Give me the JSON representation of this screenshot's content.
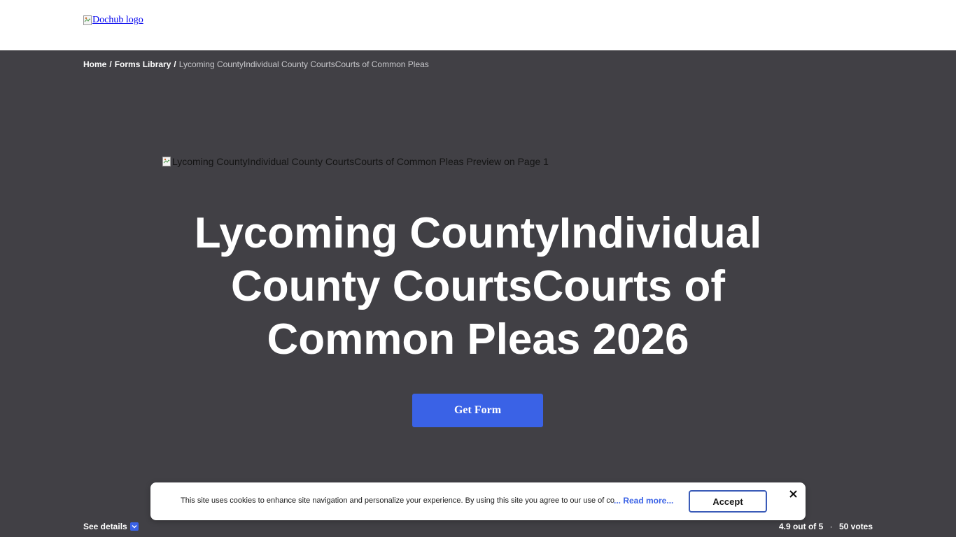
{
  "header": {
    "logo_alt": "Dochub logo"
  },
  "breadcrumb": {
    "home": "Home",
    "separator": "/",
    "forms_library": "Forms Library",
    "current": "Lycoming CountyIndividual County CourtsCourts of Common Pleas"
  },
  "preview": {
    "alt": "Lycoming CountyIndividual County CourtsCourts of Common Pleas Preview on Page 1"
  },
  "main": {
    "title": "Lycoming CountyIndividual County CourtsCourts of Common Pleas 2026",
    "get_form_label": "Get Form"
  },
  "footer": {
    "see_details_label": "See details",
    "rating_text": "4.9 out of 5",
    "rating_dot": "·",
    "votes_text": "50 votes"
  },
  "cookie": {
    "text": "This site uses cookies to enhance site navigation and personalize your experience. By using this site you agree to our use of cookies as described in our",
    "read_more": "... Read more...",
    "accept_label": "Accept"
  },
  "colors": {
    "background": "#414045",
    "accent": "#3a62e6",
    "header": "#ffffff"
  },
  "icons": {
    "logo": "broken-image-icon",
    "preview": "broken-image-icon",
    "see_details": "chevron-down-icon",
    "cookie_close": "close-icon"
  }
}
